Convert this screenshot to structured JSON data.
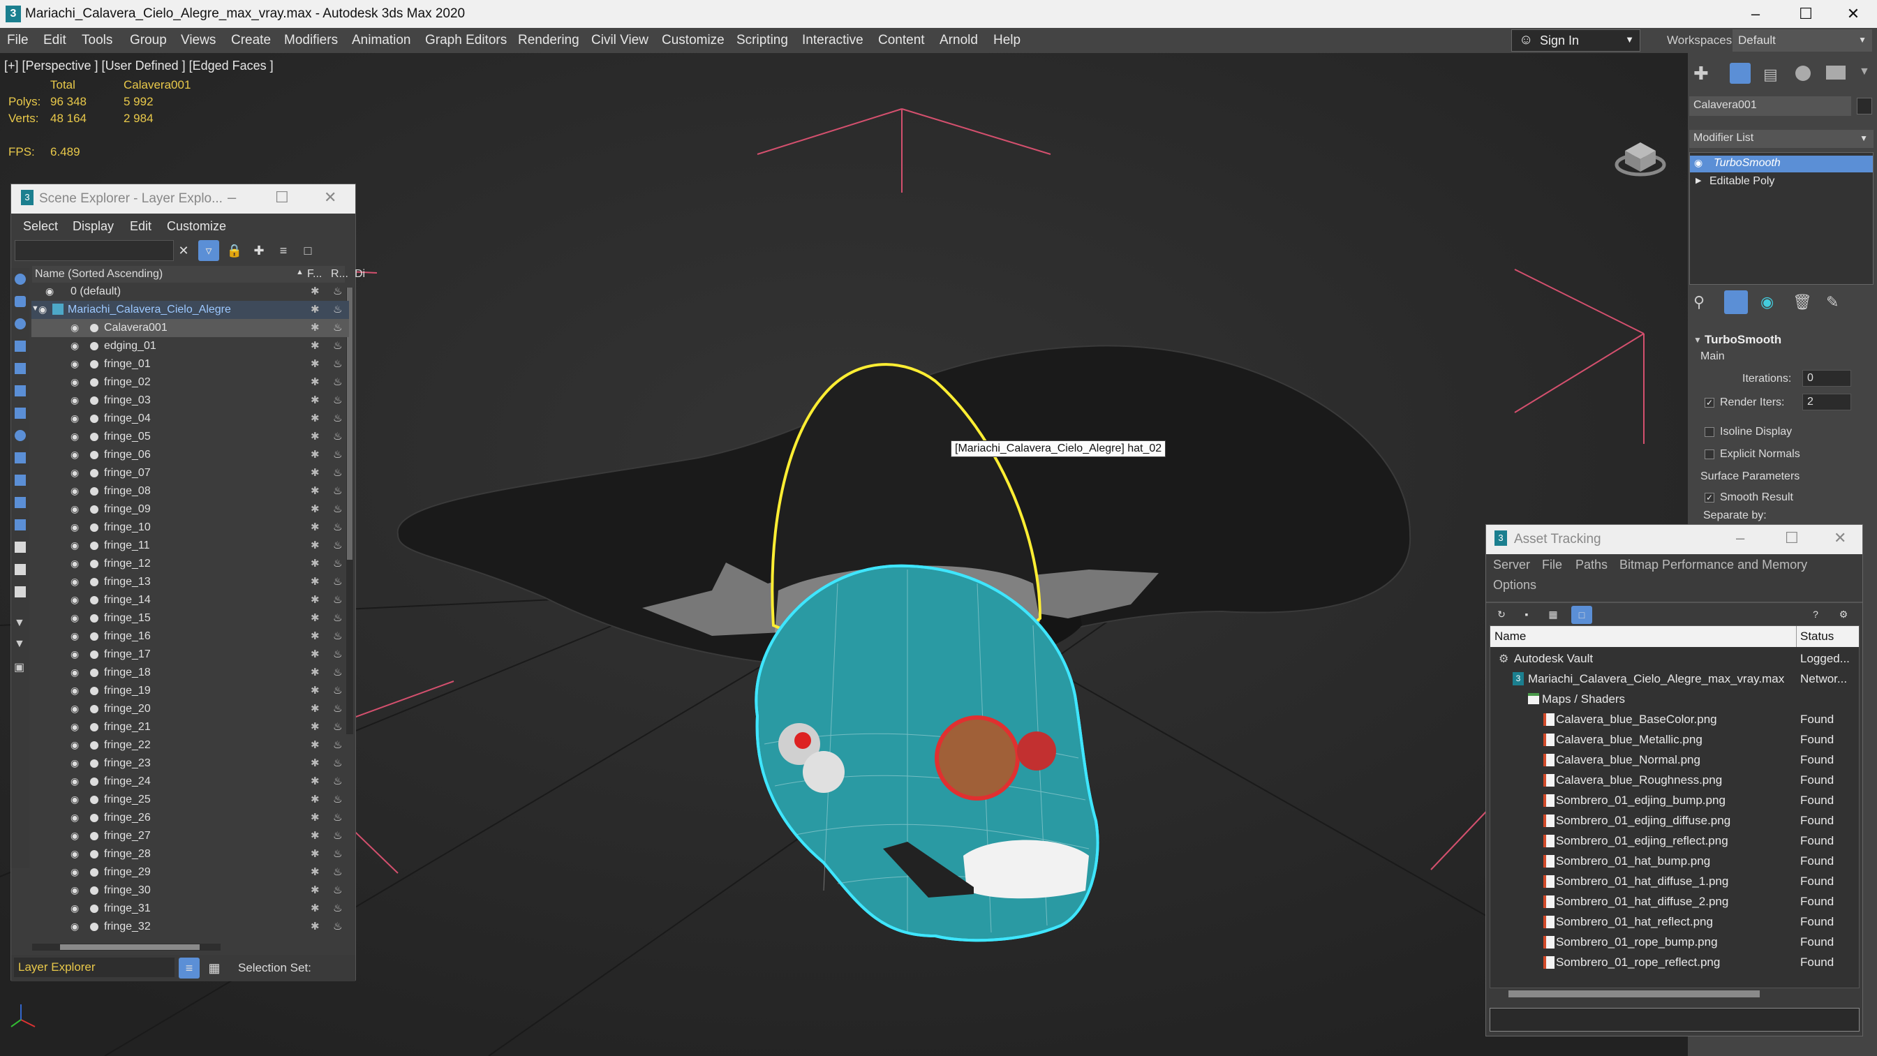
{
  "window": {
    "title": "Mariachi_Calavera_Cielo_Alegre_max_vray.max - Autodesk 3ds Max 2020",
    "app_icon": "3"
  },
  "menu": [
    "File",
    "Edit",
    "Tools",
    "Group",
    "Views",
    "Create",
    "Modifiers",
    "Animation",
    "Graph Editors",
    "Rendering",
    "Civil View",
    "Customize",
    "Scripting",
    "Interactive",
    "Content",
    "Arnold",
    "Help"
  ],
  "signin": {
    "label": "Sign In"
  },
  "workspaces": {
    "label": "Workspaces:",
    "value": "Default"
  },
  "viewport": {
    "label": "[+] [Perspective ] [User Defined ] [Edged Faces ]",
    "stats": {
      "col_total": "Total",
      "col_obj": "Calavera001",
      "polys_label": "Polys:",
      "polys_total": "96 348",
      "polys_obj": "5 992",
      "verts_label": "Verts:",
      "verts_total": "48 164",
      "verts_obj": "2 984",
      "fps_label": "FPS:",
      "fps_value": "6.489"
    },
    "tooltip": "[Mariachi_Calavera_Cielo_Alegre] hat_02"
  },
  "scene_explorer": {
    "title": "Scene Explorer - Layer Explo...",
    "menu": [
      "Select",
      "Display",
      "Edit",
      "Customize"
    ],
    "columns": {
      "name": "Name (Sorted Ascending)",
      "frozen": "F...",
      "render": "R...",
      "display": "Di"
    },
    "rows": [
      {
        "name": "0 (default)",
        "level": 0
      },
      {
        "name": "Mariachi_Calavera_Cielo_Alegre",
        "level": 1
      },
      {
        "name": "Calavera001",
        "level": 2
      },
      {
        "name": "edging_01",
        "level": 2
      },
      {
        "name": "fringe_01",
        "level": 2
      },
      {
        "name": "fringe_02",
        "level": 2
      },
      {
        "name": "fringe_03",
        "level": 2
      },
      {
        "name": "fringe_04",
        "level": 2
      },
      {
        "name": "fringe_05",
        "level": 2
      },
      {
        "name": "fringe_06",
        "level": 2
      },
      {
        "name": "fringe_07",
        "level": 2
      },
      {
        "name": "fringe_08",
        "level": 2
      },
      {
        "name": "fringe_09",
        "level": 2
      },
      {
        "name": "fringe_10",
        "level": 2
      },
      {
        "name": "fringe_11",
        "level": 2
      },
      {
        "name": "fringe_12",
        "level": 2
      },
      {
        "name": "fringe_13",
        "level": 2
      },
      {
        "name": "fringe_14",
        "level": 2
      },
      {
        "name": "fringe_15",
        "level": 2
      },
      {
        "name": "fringe_16",
        "level": 2
      },
      {
        "name": "fringe_17",
        "level": 2
      },
      {
        "name": "fringe_18",
        "level": 2
      },
      {
        "name": "fringe_19",
        "level": 2
      },
      {
        "name": "fringe_20",
        "level": 2
      },
      {
        "name": "fringe_21",
        "level": 2
      },
      {
        "name": "fringe_22",
        "level": 2
      },
      {
        "name": "fringe_23",
        "level": 2
      },
      {
        "name": "fringe_24",
        "level": 2
      },
      {
        "name": "fringe_25",
        "level": 2
      },
      {
        "name": "fringe_26",
        "level": 2
      },
      {
        "name": "fringe_27",
        "level": 2
      },
      {
        "name": "fringe_28",
        "level": 2
      },
      {
        "name": "fringe_29",
        "level": 2
      },
      {
        "name": "fringe_30",
        "level": 2
      },
      {
        "name": "fringe_31",
        "level": 2
      },
      {
        "name": "fringe_32",
        "level": 2
      }
    ],
    "footer_explorer": "Layer Explorer",
    "footer_selection": "Selection Set:"
  },
  "command_panel": {
    "object_name": "Calavera001",
    "modifier_list_label": "Modifier List",
    "stack": [
      {
        "name": "TurboSmooth",
        "selected": true
      },
      {
        "name": "Editable Poly",
        "selected": false
      }
    ],
    "rollout_title": "TurboSmooth",
    "main_label": "Main",
    "iterations_label": "Iterations:",
    "iterations_value": "0",
    "render_iters_label": "Render Iters:",
    "render_iters_value": "2",
    "isoline_label": "Isoline Display",
    "explicit_normals_label": "Explicit Normals",
    "surface_params_label": "Surface Parameters",
    "smooth_result_label": "Smooth Result",
    "separate_by_label": "Separate by:"
  },
  "asset_tracking": {
    "title": "Asset Tracking",
    "menu": [
      "Server",
      "File",
      "Paths",
      "Bitmap Performance and Memory",
      "Options"
    ],
    "columns": {
      "name": "Name",
      "status": "Status"
    },
    "rows": [
      {
        "name": "Autodesk Vault",
        "status": "Logged...",
        "indent": 1,
        "kind": "vault"
      },
      {
        "name": "Mariachi_Calavera_Cielo_Alegre_max_vray.max",
        "status": "Networ...",
        "indent": 2,
        "kind": "max"
      },
      {
        "name": "Maps / Shaders",
        "status": "",
        "indent": 3,
        "kind": "folder"
      },
      {
        "name": "Calavera_blue_BaseColor.png",
        "status": "Found",
        "indent": 4,
        "kind": "file"
      },
      {
        "name": "Calavera_blue_Metallic.png",
        "status": "Found",
        "indent": 4,
        "kind": "file"
      },
      {
        "name": "Calavera_blue_Normal.png",
        "status": "Found",
        "indent": 4,
        "kind": "file"
      },
      {
        "name": "Calavera_blue_Roughness.png",
        "status": "Found",
        "indent": 4,
        "kind": "file"
      },
      {
        "name": "Sombrero_01_edjing_bump.png",
        "status": "Found",
        "indent": 4,
        "kind": "file"
      },
      {
        "name": "Sombrero_01_edjing_diffuse.png",
        "status": "Found",
        "indent": 4,
        "kind": "file"
      },
      {
        "name": "Sombrero_01_edjing_reflect.png",
        "status": "Found",
        "indent": 4,
        "kind": "file"
      },
      {
        "name": "Sombrero_01_hat_bump.png",
        "status": "Found",
        "indent": 4,
        "kind": "file"
      },
      {
        "name": "Sombrero_01_hat_diffuse_1.png",
        "status": "Found",
        "indent": 4,
        "kind": "file"
      },
      {
        "name": "Sombrero_01_hat_diffuse_2.png",
        "status": "Found",
        "indent": 4,
        "kind": "file"
      },
      {
        "name": "Sombrero_01_hat_reflect.png",
        "status": "Found",
        "indent": 4,
        "kind": "file"
      },
      {
        "name": "Sombrero_01_rope_bump.png",
        "status": "Found",
        "indent": 4,
        "kind": "file"
      },
      {
        "name": "Sombrero_01_rope_reflect.png",
        "status": "Found",
        "indent": 4,
        "kind": "file"
      }
    ]
  },
  "colors": {
    "accent_blue": "#5b8fd6",
    "selection_yellow": "#ffee33",
    "selection_cyan": "#3fe6ff",
    "bbox_pink": "#d4506e",
    "stat_yellow": "#e9c94a"
  }
}
